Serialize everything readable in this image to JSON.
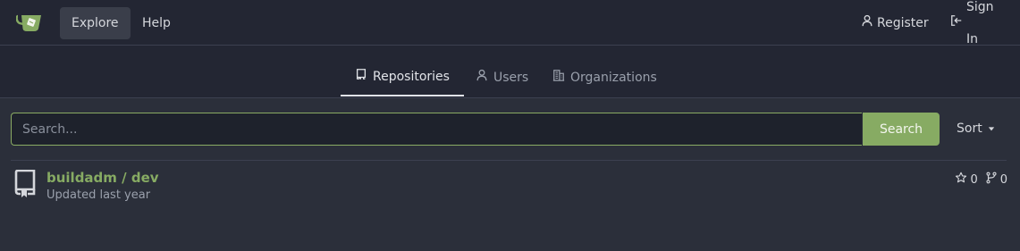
{
  "navbar": {
    "explore_label": "Explore",
    "help_label": "Help",
    "register_label": "Register",
    "signin_label": "Sign In"
  },
  "tabs": [
    {
      "label": "Repositories",
      "icon": "repo-icon",
      "active": true
    },
    {
      "label": "Users",
      "icon": "person-icon",
      "active": false
    },
    {
      "label": "Organizations",
      "icon": "organization-icon",
      "active": false
    }
  ],
  "search": {
    "placeholder": "Search...",
    "value": "",
    "button_label": "Search",
    "sort_label": "Sort"
  },
  "repos": [
    {
      "title": "buildadm / dev",
      "updated": "Updated last year",
      "stars": "0",
      "forks": "0"
    }
  ],
  "colors": {
    "accent": "#87ab63",
    "background": "#2b2f3a",
    "navbar": "#232633"
  }
}
